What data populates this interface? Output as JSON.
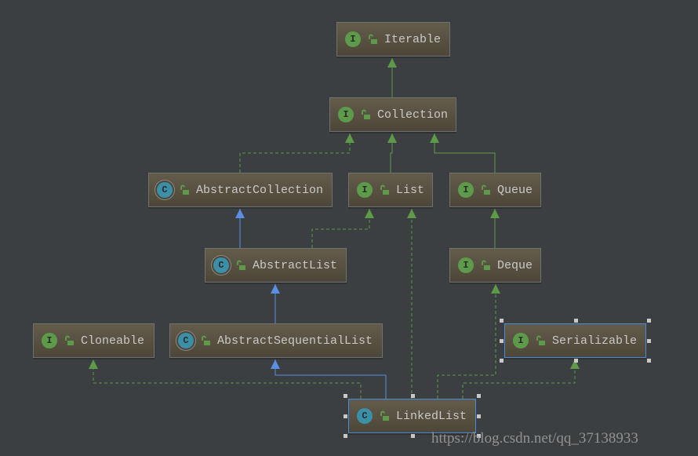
{
  "colors": {
    "background": "#3c3f41",
    "interface_badge": "#5d9a49",
    "class_badge": "#3b8fa6",
    "generalization_edge": "#5a8ee0",
    "realization_edge": "#5d9a49",
    "selection": "#4a88d8"
  },
  "nodes": {
    "iterable": {
      "name": "Iterable",
      "kind": "interface",
      "badge": "I"
    },
    "collection": {
      "name": "Collection",
      "kind": "interface",
      "badge": "I"
    },
    "abstract_collection": {
      "name": "AbstractCollection",
      "kind": "abstract-class",
      "badge": "C"
    },
    "list": {
      "name": "List",
      "kind": "interface",
      "badge": "I"
    },
    "queue": {
      "name": "Queue",
      "kind": "interface",
      "badge": "I"
    },
    "abstract_list": {
      "name": "AbstractList",
      "kind": "abstract-class",
      "badge": "C"
    },
    "deque": {
      "name": "Deque",
      "kind": "interface",
      "badge": "I"
    },
    "cloneable": {
      "name": "Cloneable",
      "kind": "interface",
      "badge": "I"
    },
    "abstract_sequential_list": {
      "name": "AbstractSequentialList",
      "kind": "abstract-class",
      "badge": "C"
    },
    "serializable": {
      "name": "Serializable",
      "kind": "interface",
      "badge": "I",
      "selected": true
    },
    "linked_list": {
      "name": "LinkedList",
      "kind": "class",
      "badge": "C",
      "selected": true
    }
  },
  "edges": [
    {
      "from": "Collection",
      "to": "Iterable",
      "type": "interface-extends"
    },
    {
      "from": "AbstractCollection",
      "to": "Collection",
      "type": "implements"
    },
    {
      "from": "List",
      "to": "Collection",
      "type": "interface-extends"
    },
    {
      "from": "Queue",
      "to": "Collection",
      "type": "interface-extends"
    },
    {
      "from": "AbstractList",
      "to": "AbstractCollection",
      "type": "extends"
    },
    {
      "from": "AbstractList",
      "to": "List",
      "type": "implements"
    },
    {
      "from": "Deque",
      "to": "Queue",
      "type": "interface-extends"
    },
    {
      "from": "AbstractSequentialList",
      "to": "AbstractList",
      "type": "extends"
    },
    {
      "from": "LinkedList",
      "to": "AbstractSequentialList",
      "type": "extends"
    },
    {
      "from": "LinkedList",
      "to": "Cloneable",
      "type": "implements"
    },
    {
      "from": "LinkedList",
      "to": "List",
      "type": "implements"
    },
    {
      "from": "LinkedList",
      "to": "Deque",
      "type": "implements"
    },
    {
      "from": "LinkedList",
      "to": "Serializable",
      "type": "implements"
    }
  ],
  "watermark": "https://blog.csdn.net/qq_37138933"
}
